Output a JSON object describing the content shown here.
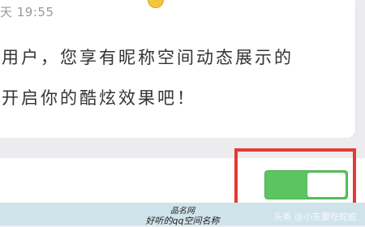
{
  "message": {
    "timestamp": "天 19:55",
    "emoji_icon": "smiley-emoji",
    "line1": "用户，您享有昵称空间动态展示的",
    "line2": "开启你的酷炫效果吧！"
  },
  "setting": {
    "toggle_state": "on",
    "toggle_color": "#5cc460",
    "highlight_color": "#e53935"
  },
  "caption": {
    "site": "品名网",
    "title": "好听的qq空间名称"
  },
  "watermark": "头条 @小东要吃蛇蛇"
}
